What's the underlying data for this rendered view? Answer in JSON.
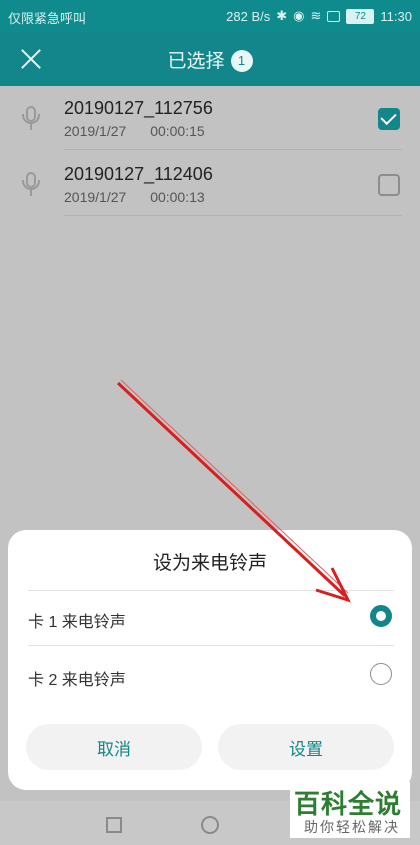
{
  "status_bar": {
    "left_text": "仅限紧急呼叫",
    "speed": "282 B/s",
    "battery": "72",
    "time": "11:30"
  },
  "app_bar": {
    "title": "已选择",
    "selected_count": "1"
  },
  "recordings": [
    {
      "name": "20190127_112756",
      "date": "2019/1/27",
      "duration": "00:00:15",
      "checked": true
    },
    {
      "name": "20190127_112406",
      "date": "2019/1/27",
      "duration": "00:00:13",
      "checked": false
    }
  ],
  "dialog": {
    "title": "设为来电铃声",
    "options": [
      {
        "label": "卡 1 来电铃声",
        "selected": true
      },
      {
        "label": "卡 2 来电铃声",
        "selected": false
      }
    ],
    "cancel_label": "取消",
    "confirm_label": "设置"
  },
  "watermark": {
    "title": "百科全说",
    "subtitle": "助你轻松解决"
  },
  "colors": {
    "accent": "#12868a",
    "annotation": "#d81e1e"
  }
}
